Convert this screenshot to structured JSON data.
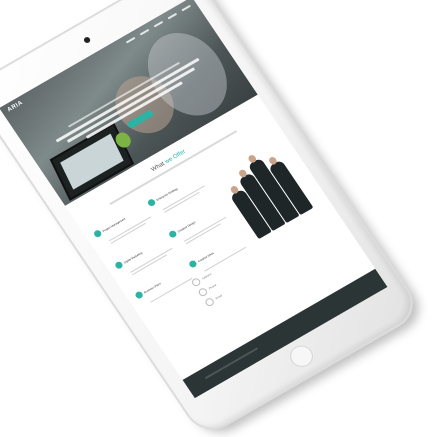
{
  "site": {
    "logo": "ARIA",
    "hero_cta": ""
  },
  "section": {
    "title_lead": "What ",
    "title_accent": "we Offer"
  },
  "features": [
    {
      "label": "Project Management"
    },
    {
      "label": "Enterprise Strategy"
    },
    {
      "label": "Digital Marketing"
    },
    {
      "label": "Creative Design"
    },
    {
      "label": "Business Plans"
    },
    {
      "label": "Creative Ideas"
    }
  ],
  "contacts": [
    {
      "text": "Address"
    },
    {
      "text": "Phone"
    },
    {
      "text": "Email"
    }
  ],
  "colors": {
    "accent": "#2bb3a3",
    "hero_overlay": "#4c5556",
    "footer": "#2c3536"
  }
}
